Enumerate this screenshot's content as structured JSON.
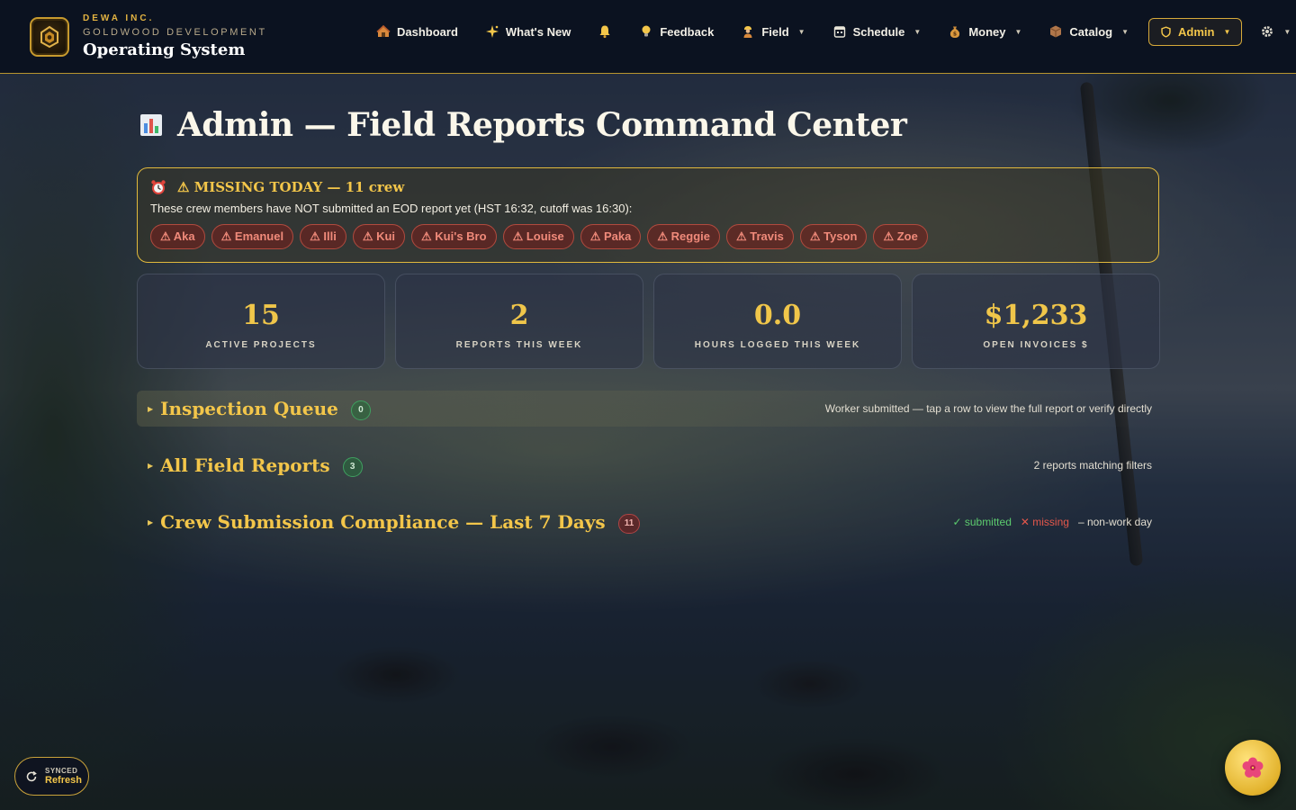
{
  "brand": {
    "line1": "DEWA INC.",
    "line2": "GOLDWOOD DEVELOPMENT",
    "line3": "Operating System"
  },
  "nav": {
    "items": [
      {
        "label": "Dashboard",
        "icon": "house-icon"
      },
      {
        "label": "What's New",
        "icon": "sparkles-icon"
      },
      {
        "label": "",
        "icon": "bell-icon"
      },
      {
        "label": "Feedback",
        "icon": "lightbulb-icon"
      },
      {
        "label": "Field",
        "icon": "worker-icon"
      },
      {
        "label": "Schedule",
        "icon": "calendar-icon"
      },
      {
        "label": "Money",
        "icon": "money-bag-icon"
      },
      {
        "label": "Catalog",
        "icon": "box-icon"
      },
      {
        "label": "Admin",
        "icon": "shield-icon"
      }
    ],
    "settings_icon": "gear-icon"
  },
  "page": {
    "title": "Admin — Field Reports Command Center",
    "title_icon": "bar-chart-icon"
  },
  "missing": {
    "title": "⚠ MISSING TODAY — 11 crew",
    "description": "These crew members have NOT submitted an EOD report yet (HST 16:32, cutoff was 16:30):",
    "crew": [
      "⚠ Aka",
      "⚠ Emanuel",
      "⚠ Illi",
      "⚠ Kui",
      "⚠ Kui's Bro",
      "⚠ Louise",
      "⚠ Paka",
      "⚠ Reggie",
      "⚠ Travis",
      "⚠ Tyson",
      "⚠ Zoe"
    ]
  },
  "stats": [
    {
      "value": "15",
      "label": "ACTIVE PROJECTS"
    },
    {
      "value": "2",
      "label": "REPORTS THIS WEEK"
    },
    {
      "value": "0.0",
      "label": "HOURS LOGGED THIS WEEK"
    },
    {
      "value": "$1,233",
      "label": "OPEN INVOICES $"
    }
  ],
  "sections": {
    "inspection": {
      "title": "Inspection Queue",
      "count": "0",
      "note": "Worker submitted — tap a row to view the full report or verify directly"
    },
    "reports": {
      "title": "All Field Reports",
      "count": "3",
      "note": "2 reports matching filters"
    },
    "compliance": {
      "title": "Crew Submission Compliance — Last 7 Days",
      "count": "11",
      "legend_submitted": "✓ submitted",
      "legend_missing": "✕ missing",
      "legend_nonwork": "– non-work day"
    }
  },
  "refresh": {
    "status": "SYNCED",
    "label": "Refresh"
  },
  "colors": {
    "accent": "#f3c64a",
    "danger": "#f08a7a",
    "success": "#5ccb6e",
    "header_bg": "#0b1220"
  }
}
